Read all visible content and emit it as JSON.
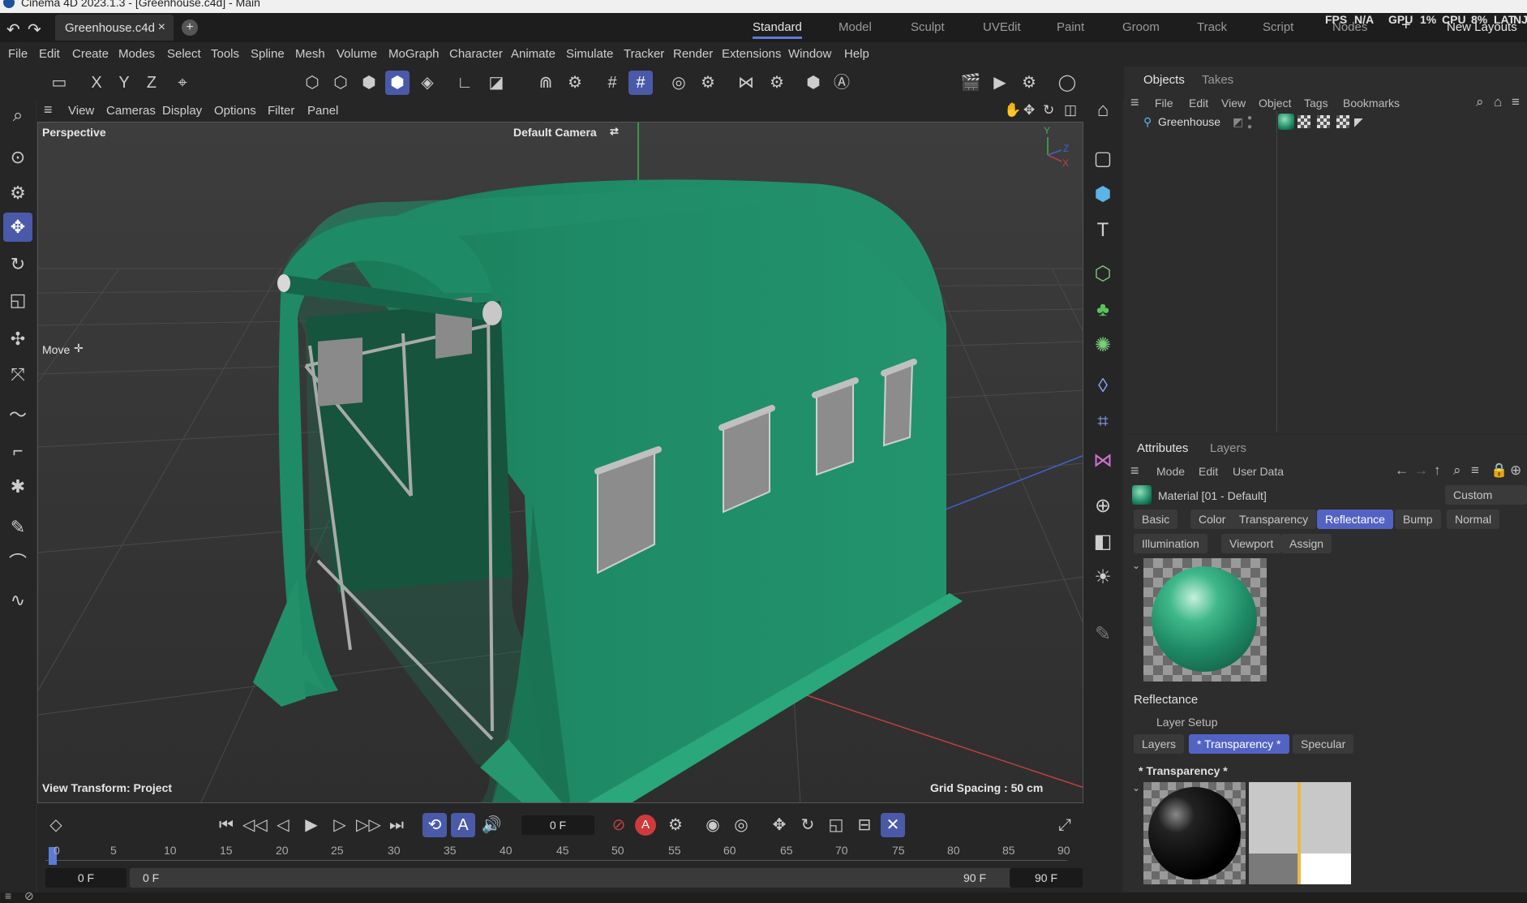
{
  "window": {
    "title": "Cinema 4D 2023.1.3 - [Greenhouse.c4d] - Main"
  },
  "tabs": {
    "doc_name": "Greenhouse.c4d",
    "close": "×",
    "add": "+"
  },
  "layouts": [
    "Standard",
    "Model",
    "Sculpt",
    "UVEdit",
    "Paint",
    "Groom",
    "Track",
    "Script",
    "Nodes"
  ],
  "layout_active": "Standard",
  "stats": {
    "fps": "FPS",
    "fps_val": "N/A",
    "gpu": "GPU",
    "gpu_val": "1%",
    "cpu": "CPU",
    "cpu_val": "8%",
    "lat": "LAT",
    "nj": "NJ"
  },
  "new_layouts": "New Layouts",
  "menu": [
    "File",
    "Edit",
    "Create",
    "Modes",
    "Select",
    "Tools",
    "Spline",
    "Mesh",
    "Volume",
    "MoGraph",
    "Character",
    "Animate",
    "Simulate",
    "Tracker",
    "Render",
    "Extensions",
    "Window",
    "Help"
  ],
  "axes": {
    "x": "X",
    "y": "Y",
    "z": "Z"
  },
  "viewport_menu": [
    "View",
    "Cameras",
    "Display",
    "Options",
    "Filter",
    "Panel"
  ],
  "viewport": {
    "mode": "Perspective",
    "camera": "Default Camera",
    "tool": "Move",
    "view_transform": "View Transform: Project",
    "grid_spacing": "Grid Spacing : 50 cm"
  },
  "timeline": {
    "current_frame": "0 F",
    "start": "0 F",
    "start2": "0 F",
    "end": "90 F",
    "end2": "90 F",
    "ruler": [
      "0",
      "5",
      "10",
      "15",
      "20",
      "25",
      "30",
      "35",
      "40",
      "45",
      "50",
      "55",
      "60",
      "65",
      "70",
      "75",
      "80",
      "85",
      "90"
    ]
  },
  "objects_panel": {
    "tabs": [
      "Objects",
      "Takes"
    ],
    "menu": [
      "File",
      "Edit",
      "View",
      "Object",
      "Tags",
      "Bookmarks"
    ],
    "tree": [
      {
        "name": "Greenhouse"
      }
    ]
  },
  "attributes_panel": {
    "tabs": [
      "Attributes",
      "Layers"
    ],
    "menu": [
      "Mode",
      "Edit",
      "User Data"
    ],
    "material_name": "Material [01 - Default]",
    "preset": "Custom",
    "channel_tabs": [
      "Basic",
      "Color",
      "Transparency",
      "Reflectance",
      "Bump",
      "Normal",
      "Illumination",
      "Viewport",
      "Assign"
    ],
    "channel_active": "Reflectance",
    "section": "Reflectance",
    "layer_setup": "Layer Setup",
    "layer_tabs": [
      "Layers",
      "* Transparency *",
      "Specular"
    ],
    "layer_active": "* Transparency *",
    "layer_title": "* Transparency *"
  },
  "colors": {
    "accent": "#4a5aa8",
    "greenhouse": "#1f8a66",
    "grid_axis_x": "#c04040",
    "grid_axis_y": "#3bb54a",
    "grid_axis_z": "#4060d0"
  }
}
